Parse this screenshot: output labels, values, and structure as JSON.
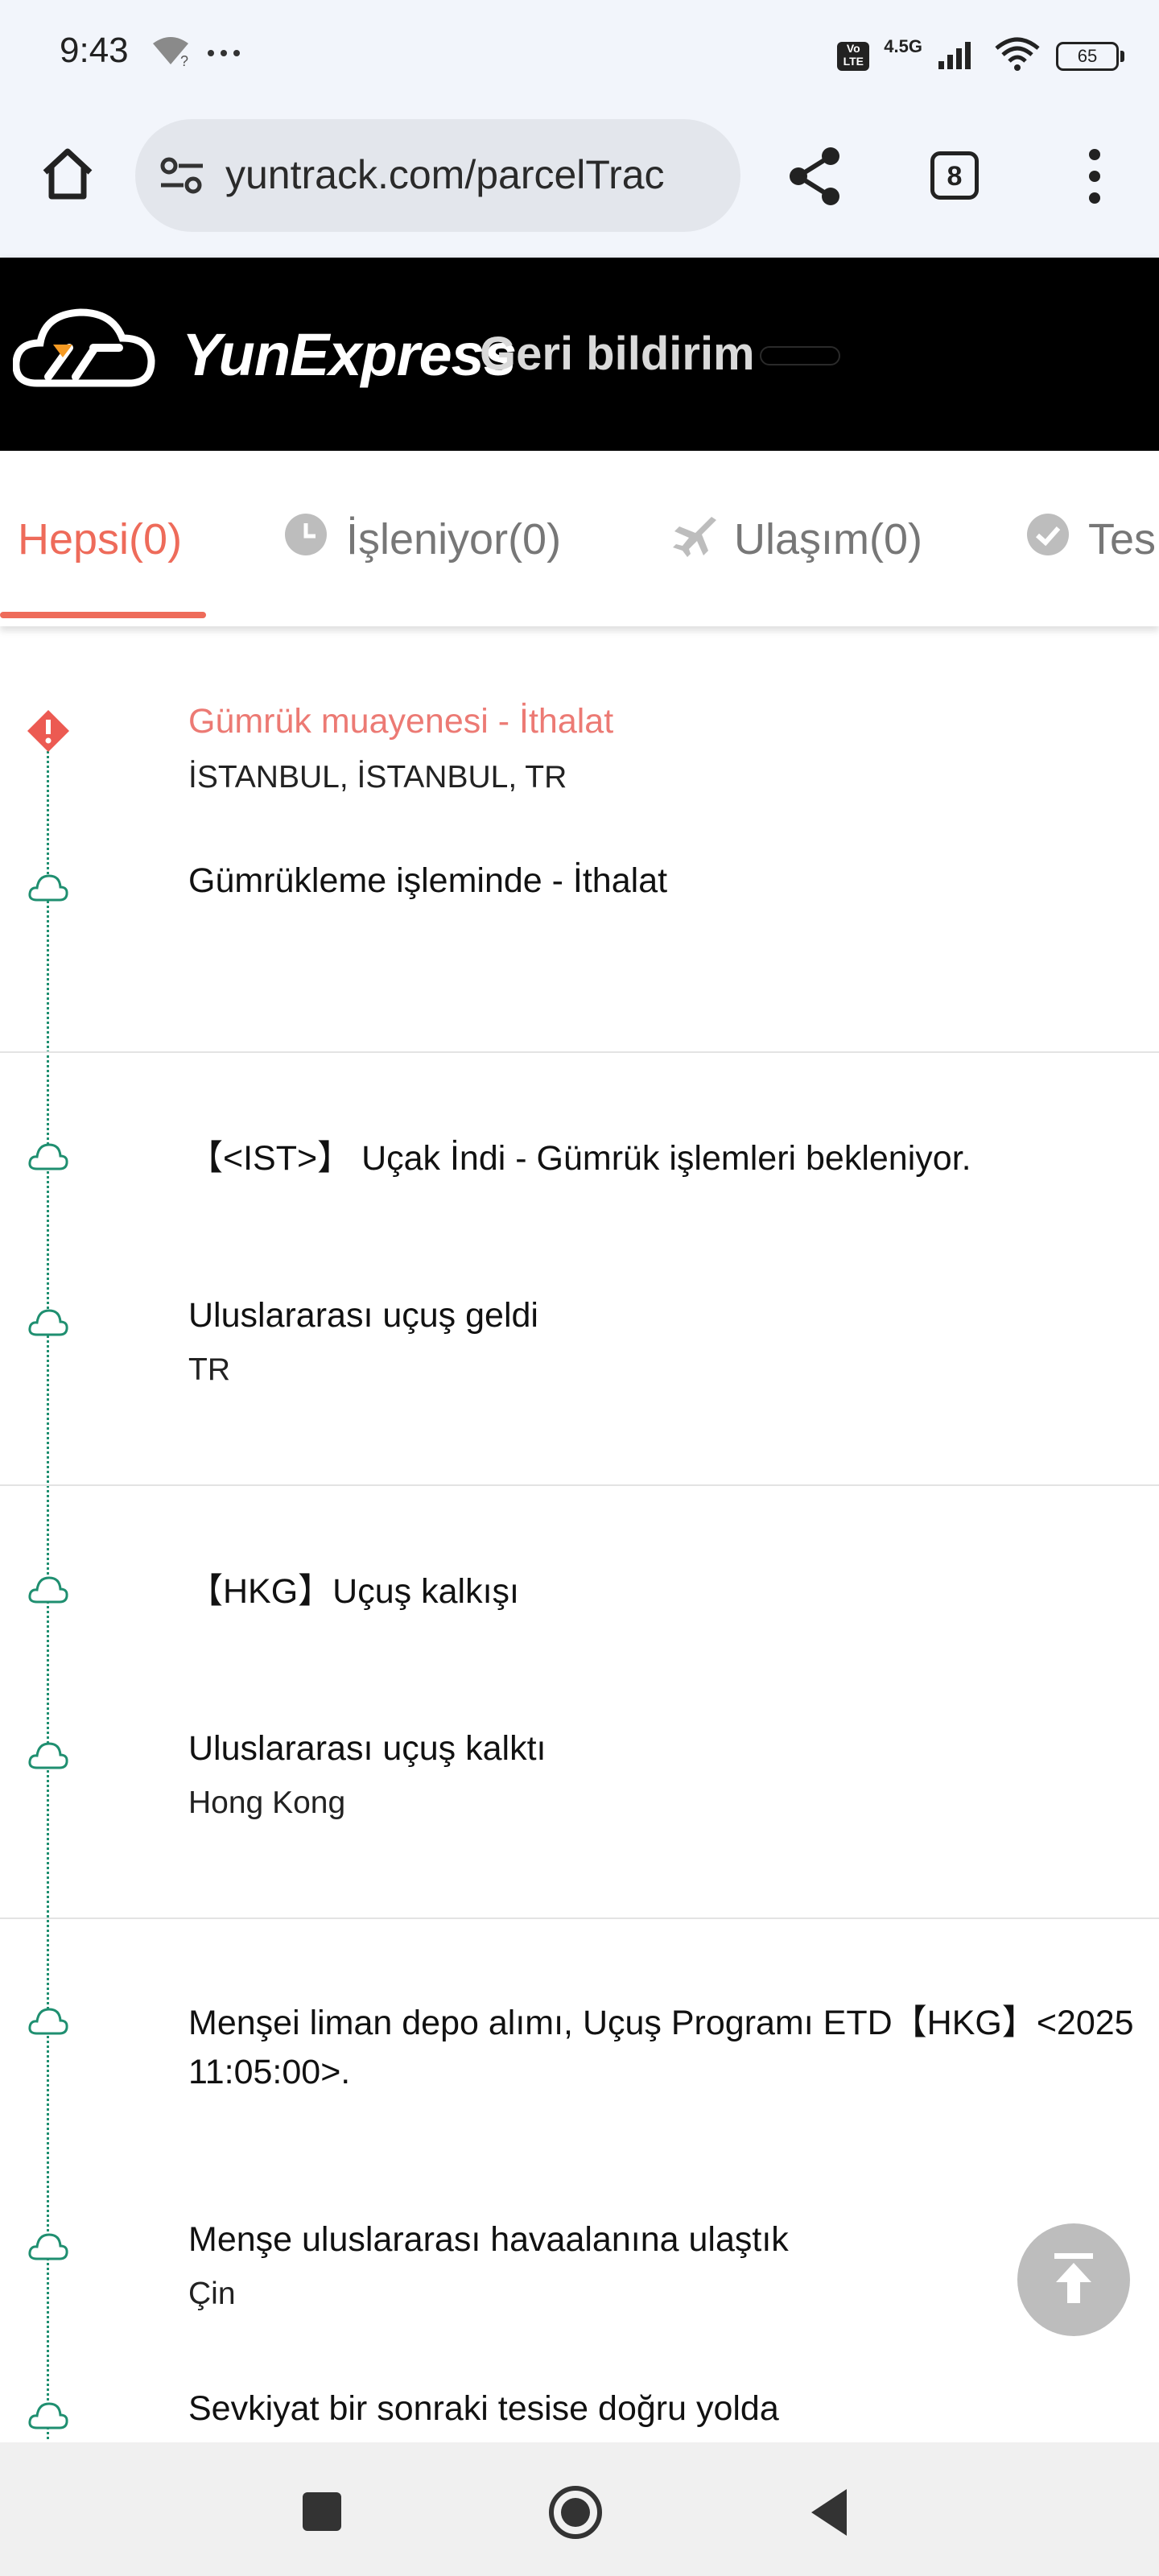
{
  "status_bar": {
    "time": "9:43",
    "extra": "•••",
    "volte": "Vo LTE",
    "network": "4.5G",
    "battery": "65"
  },
  "browser": {
    "url": "yuntrack.com/parcelTrac",
    "tab_count": "8"
  },
  "header": {
    "brand": "YunExpress",
    "feedback": "Geri bildirim"
  },
  "tabs": [
    {
      "label": "Hepsi(0)",
      "icon": "none",
      "active": true
    },
    {
      "label": "İşleniyor(0)",
      "icon": "clock-icon",
      "active": false
    },
    {
      "label": "Ulaşım(0)",
      "icon": "plane-icon",
      "active": false
    },
    {
      "label": "Tes",
      "icon": "check-circle-icon",
      "active": false
    }
  ],
  "events": [
    {
      "title": "Gümrük muayenesi - İthalat",
      "location": "İSTANBUL, İSTANBUL, TR",
      "status": "alert"
    },
    {
      "title": "Gümrükleme işleminde - İthalat",
      "location": ""
    },
    {
      "title": "【<IST>】 Uçak İndi - Gümrük işlemleri bekleniyor.",
      "location": ""
    },
    {
      "title": "Uluslararası uçuş geldi",
      "location": "TR"
    },
    {
      "title": "【HKG】Uçuş kalkışı",
      "location": ""
    },
    {
      "title": "Uluslararası uçuş kalktı",
      "location": "Hong Kong"
    },
    {
      "title": "Menşei liman depo alımı, Uçuş Programı ETD【HKG】<2025",
      "title_line2": "11:05:00>.",
      "location": ""
    },
    {
      "title": "Menşe uluslararası havaalanına ulaştık",
      "location": "Çin"
    },
    {
      "title": "Sevkiyat bir sonraki tesise doğru yolda",
      "location": ""
    }
  ],
  "colors": {
    "accent": "#ee6b5a",
    "timeline": "#1f8f70",
    "alert": "#ec7a74"
  }
}
